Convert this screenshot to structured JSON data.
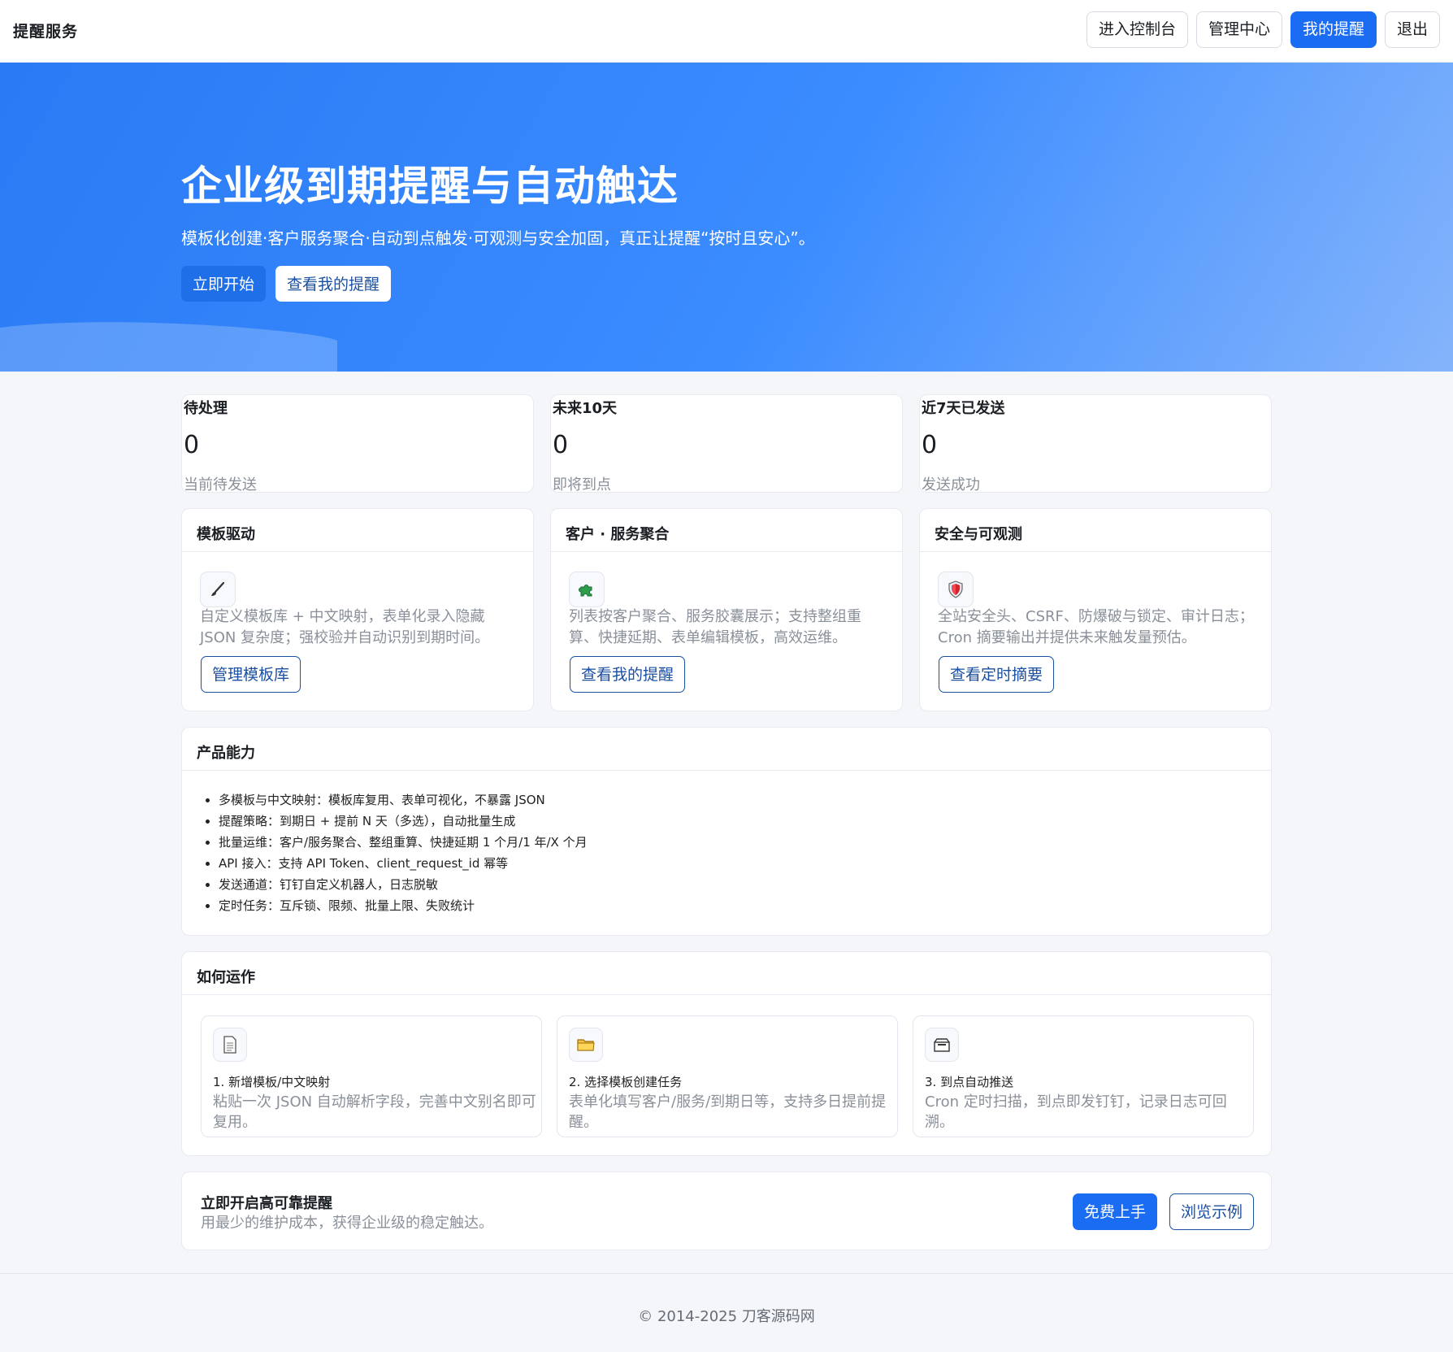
{
  "navbar": {
    "brand": "提醒服务",
    "buttons": [
      "进入控制台",
      "管理中心",
      "我的提醒",
      "退出"
    ]
  },
  "hero": {
    "title": "企业级到期提醒与自动触达",
    "subtitle": "模板化创建·客户服务聚合·自动到点触发·可观测与安全加固，真正让提醒“按时且安心”。",
    "primary_button": "立即开始",
    "secondary_button": "查看我的提醒"
  },
  "stats": [
    {
      "label": "待处理",
      "value": "0",
      "sub": "当前待发送"
    },
    {
      "label": "未来10天",
      "value": "0",
      "sub": "即将到点"
    },
    {
      "label": "近7天已发送",
      "value": "0",
      "sub": "发送成功"
    }
  ],
  "features": [
    {
      "title": "模板驱动",
      "icon": "brush-icon",
      "desc": "自定义模板库 + 中文映射，表单化录入隐藏 JSON 复杂度；强校验并自动识别到期时间。",
      "button": "管理模板库"
    },
    {
      "title": "客户 · 服务聚合",
      "icon": "puzzle-icon",
      "desc": "列表按客户聚合、服务胶囊展示；支持整组重算、快捷延期、表单编辑模板，高效运维。",
      "button": "查看我的提醒"
    },
    {
      "title": "安全与可观测",
      "icon": "shield-icon",
      "desc": "全站安全头、CSRF、防爆破与锁定、审计日志；Cron 摘要输出并提供未来触发量预估。",
      "button": "查看定时摘要"
    }
  ],
  "capabilities": {
    "title": "产品能力",
    "items": [
      "多模板与中文映射：模板库复用、表单可视化，不暴露 JSON",
      "提醒策略：到期日 + 提前 N 天（多选），自动批量生成",
      "批量运维：客户/服务聚合、整组重算、快捷延期 1 个月/1 年/X 个月",
      "API 接入：支持 API Token、client_request_id 幂等",
      "发送通道：钉钉自定义机器人，日志脱敏",
      "定时任务：互斥锁、限频、批量上限、失败统计"
    ]
  },
  "how": {
    "title": "如何运作",
    "steps": [
      {
        "icon": "document-icon",
        "title": "1. 新增模板/中文映射",
        "desc": "粘贴一次 JSON 自动解析字段，完善中文别名即可复用。"
      },
      {
        "icon": "folder-icon",
        "title": "2. 选择模板创建任务",
        "desc": "表单化填写客户/服务/到期日等，支持多日提前提醒。"
      },
      {
        "icon": "mailbox-icon",
        "title": "3. 到点自动推送",
        "desc": "Cron 定时扫描，到点即发钉钉，记录日志可回溯。"
      }
    ]
  },
  "cta": {
    "title": "立即开启高可靠提醒",
    "subtitle": "用最少的维护成本，获得企业级的稳定触达。",
    "primary_button": "免费上手",
    "secondary_button": "浏览示例"
  },
  "footer": {
    "text": "© 2014-2025 刀客源码网"
  },
  "colors": {
    "accent": "#1a6cf2",
    "hero_start": "#2a7af5",
    "hero_end": "#84b4fb",
    "muted_text": "#8a9099"
  }
}
